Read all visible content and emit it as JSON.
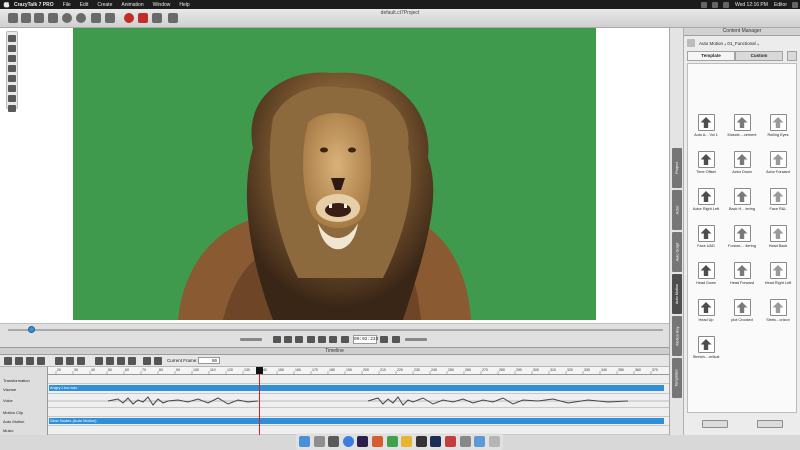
{
  "menubar": {
    "items": [
      "CrazyTalk 7 PRO",
      "File",
      "Edit",
      "Create",
      "Animation",
      "Window",
      "Help"
    ],
    "clock": "Wed 12:16 PM",
    "user": "Editor"
  },
  "window": {
    "title": "default.ct7Project"
  },
  "transport": {
    "time": "00:02:233"
  },
  "timeline": {
    "title": "Timeline",
    "current_frame_label": "Current Frame:",
    "current_frame_value": "86",
    "tracks": [
      "Transformation",
      "Viseme",
      "Voice",
      "Motion Clip",
      "Auto Motion",
      "Music"
    ],
    "viseme_clip": "Angry Lion.wav",
    "auto_motion_clip": "Slow Nodes (Auto Motion)",
    "ruler_ticks": [
      "20",
      "30",
      "40",
      "50",
      "60",
      "70",
      "80",
      "90",
      "100",
      "110",
      "120",
      "130",
      "140",
      "150",
      "160",
      "170",
      "180",
      "190",
      "200",
      "210",
      "220",
      "230",
      "240",
      "250",
      "260",
      "270",
      "280",
      "290",
      "300",
      "310",
      "320",
      "330",
      "340",
      "350",
      "360",
      "370"
    ]
  },
  "side_tabs": [
    "Project",
    "Actor",
    "Auto Script",
    "Auto Motion",
    "Motion Key",
    "Templates"
  ],
  "content_manager": {
    "title": "Content Manager",
    "path": "Auto Motion ₄ 01_Functional ₄",
    "tabs": [
      "Template",
      "Custom"
    ],
    "items": [
      "Auto A... Vol 1",
      "Muscle-...cement",
      "Rolling Eyes",
      "Time Offset",
      "Actor Down",
      "Actor Forward",
      "Actor Right Left",
      "Back H... tering",
      "Face R&L",
      "Face U&D",
      "Forwar-... tiering",
      "Head Back",
      "Head Down",
      "Head Forward",
      "Head Right Left",
      "Head Up",
      "plot Crooked",
      "Stretc...orizon",
      "Stretch-...ertical"
    ]
  }
}
